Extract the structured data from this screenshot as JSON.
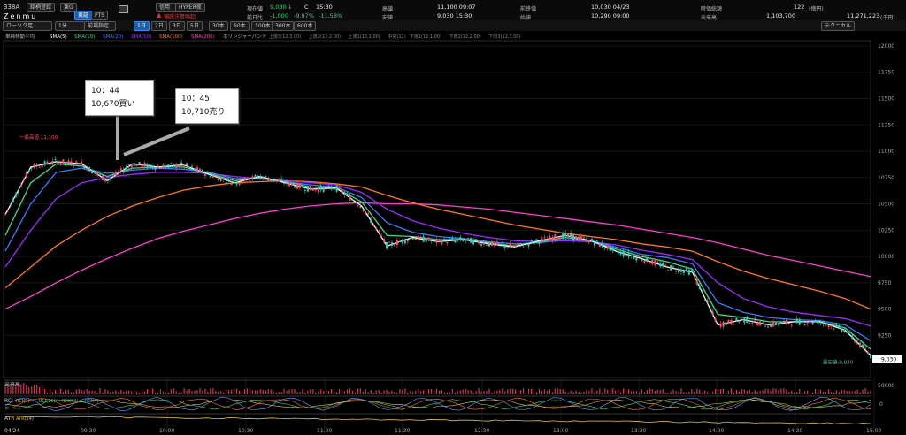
{
  "header": {
    "code": "338A",
    "name": "Zenmu",
    "buttons": [
      "銘柄登録",
      "東G"
    ],
    "market_tabs": [
      "東証",
      "PTS"
    ],
    "credit": "信用",
    "hyper": "HYPER夜",
    "warning": "預託注意喚起",
    "quote": {
      "current_label": "現在値",
      "current_value": "9,030",
      "current_mark": "↓",
      "current_time": "15:30",
      "mark_c": "C",
      "prev_label": "前日比",
      "prev_value": "-1,000",
      "prev_pct": "-9.97%",
      "prev_pct2": "-11.58%",
      "high_label": "高値",
      "high_value": "11,100 09:07",
      "low_label": "安値",
      "low_value": "9,030 15:30",
      "prevclose_label": "前終値",
      "prevclose_value": "10,030 04/23",
      "open_label": "始値",
      "open_value": "10,290 09:00",
      "mcap_label": "時価総額",
      "mcap_value": "122",
      "mcap_unit": "(億円)",
      "volume_label": "出来高",
      "volume_value": "1,103,700",
      "turnover_value": "11,271,223",
      "turnover_unit": "(千円)"
    }
  },
  "toolbar": {
    "chart_type": "ローソク足",
    "interval": "1分",
    "adjust": "前場指定",
    "periods": [
      "1日",
      "2日",
      "3日",
      "5日",
      "30本",
      "60本",
      "100本",
      "300本",
      "600本"
    ],
    "active_period": "1日",
    "technical": "テクニカル"
  },
  "legend": {
    "title": "単純移動平均",
    "items": [
      {
        "label": "SMA(5)",
        "color": "#ffffff"
      },
      {
        "label": "SMA(10)",
        "color": "#3ddc84"
      },
      {
        "label": "SMA(20)",
        "color": "#3a7bff"
      },
      {
        "label": "SMA(50)",
        "color": "#9b2cff"
      },
      {
        "label": "SMA(100)",
        "color": "#ff7a1a"
      },
      {
        "label": "SMA(200)",
        "color": "#ff3fd0"
      }
    ],
    "bollinger": "ボリンジャーバンド",
    "bands": [
      "上限3(12,3.00)",
      "上限2(12,2.00)",
      "上限1(12,1.00)",
      "中央(12)",
      "下限1(12,1.00)",
      "下限2(12,2.00)",
      "下限3(12,3.00)"
    ]
  },
  "annotations": [
    {
      "time": "10：44",
      "text": "10,670買い"
    },
    {
      "time": "10：45",
      "text": "10,710売り"
    }
  ],
  "chart_data": {
    "type": "line",
    "x": [
      "09:00",
      "09:10",
      "09:20",
      "09:30",
      "09:40",
      "09:50",
      "10:00",
      "10:10",
      "10:20",
      "10:30",
      "10:40",
      "10:50",
      "11:00",
      "11:10",
      "11:20",
      "11:30",
      "12:30",
      "12:40",
      "12:50",
      "13:00",
      "13:10",
      "13:20",
      "13:30",
      "13:40",
      "13:50",
      "14:00",
      "14:10",
      "14:20",
      "14:30",
      "14:40",
      "14:50",
      "15:00",
      "15:10",
      "15:20",
      "15:30"
    ],
    "series": [
      {
        "name": "SMA(5)",
        "color": "#ffffff",
        "values": [
          10400,
          10850,
          10900,
          10880,
          10720,
          10880,
          10850,
          10870,
          10780,
          10700,
          10760,
          10700,
          10640,
          10650,
          10480,
          10100,
          10180,
          10140,
          10160,
          10120,
          10090,
          10150,
          10200,
          10150,
          10050,
          9980,
          9900,
          9850,
          9350,
          9400,
          9350,
          9380,
          9380,
          9300,
          9060
        ]
      },
      {
        "name": "SMA(10)",
        "color": "#3ddc84",
        "values": [
          10200,
          10700,
          10880,
          10860,
          10760,
          10840,
          10850,
          10850,
          10790,
          10720,
          10750,
          10710,
          10660,
          10650,
          10520,
          10200,
          10190,
          10160,
          10160,
          10130,
          10100,
          10140,
          10180,
          10150,
          10070,
          10000,
          9950,
          9880,
          9450,
          9420,
          9380,
          9380,
          9380,
          9320,
          9120
        ]
      },
      {
        "name": "SMA(20)",
        "color": "#3a7bff",
        "values": [
          10050,
          10500,
          10800,
          10840,
          10790,
          10820,
          10840,
          10830,
          10800,
          10740,
          10740,
          10710,
          10680,
          10660,
          10560,
          10320,
          10230,
          10190,
          10170,
          10140,
          10120,
          10130,
          10160,
          10150,
          10090,
          10020,
          9990,
          9930,
          9560,
          9470,
          9420,
          9400,
          9390,
          9350,
          9200
        ]
      },
      {
        "name": "SMA(50)",
        "color": "#9b2cff",
        "values": [
          9900,
          10250,
          10550,
          10700,
          10750,
          10780,
          10800,
          10800,
          10790,
          10760,
          10740,
          10720,
          10700,
          10680,
          10610,
          10450,
          10340,
          10270,
          10220,
          10180,
          10150,
          10140,
          10150,
          10140,
          10110,
          10060,
          10020,
          9970,
          9750,
          9600,
          9520,
          9470,
          9440,
          9410,
          9340
        ]
      },
      {
        "name": "SMA(100)",
        "color": "#ff7a1a",
        "values": [
          9700,
          9900,
          10100,
          10250,
          10380,
          10480,
          10560,
          10630,
          10670,
          10700,
          10710,
          10720,
          10710,
          10690,
          10660,
          10580,
          10510,
          10450,
          10400,
          10350,
          10300,
          10260,
          10220,
          10190,
          10160,
          10120,
          10090,
          10050,
          9950,
          9860,
          9790,
          9730,
          9670,
          9600,
          9500
        ]
      },
      {
        "name": "SMA(200)",
        "color": "#ff3fd0",
        "values": [
          9500,
          9620,
          9750,
          9870,
          9980,
          10080,
          10170,
          10240,
          10300,
          10360,
          10410,
          10450,
          10480,
          10500,
          10510,
          10500,
          10500,
          10490,
          10470,
          10450,
          10420,
          10390,
          10360,
          10330,
          10300,
          10260,
          10220,
          10180,
          10130,
          10070,
          10010,
          9960,
          9910,
          9860,
          9810
        ]
      }
    ],
    "y_ticks": [
      12000,
      11750,
      11500,
      11250,
      11000,
      10750,
      10500,
      10250,
      10000,
      9750,
      9500,
      9250
    ],
    "ylim": [
      8850,
      12050
    ],
    "x_ticks": [
      "09:30",
      "10:00",
      "10:30",
      "11:00",
      "11:30",
      "12:30",
      "13:00",
      "13:30",
      "14:00",
      "14:30",
      "15:00"
    ],
    "high_label": "一最高値:11,100",
    "low_label": "最安値:9,030",
    "current_tag": "9,030",
    "volume": {
      "label": "出来高",
      "axis_label": "50000",
      "color": "#e0305a"
    },
    "rci": {
      "label": "RCI",
      "items": [
        {
          "label": "RCI(9)",
          "color": "#e0c040"
        },
        {
          "label": "RCI(26)",
          "color": "#3ddc84"
        },
        {
          "label": "RCI(52)",
          "color": "#ff7a1a"
        },
        {
          "label": "RCI(4)",
          "color": "#6aa0ff"
        }
      ],
      "axis_label": "0"
    },
    "atr": {
      "label": "ATR",
      "item": "ATR(14)",
      "color": "#e0c040"
    },
    "date_label": "04/24"
  }
}
